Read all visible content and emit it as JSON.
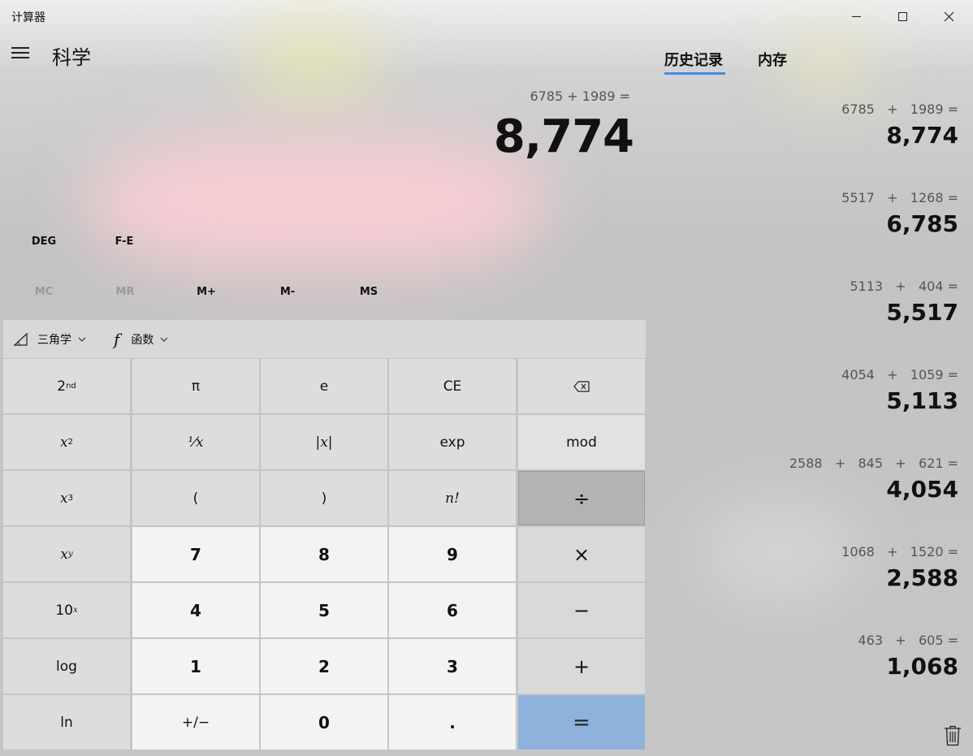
{
  "window": {
    "title": "计算器"
  },
  "header": {
    "mode": "科学"
  },
  "display": {
    "expression": "6785 + 1989 =",
    "result": "8,774"
  },
  "modes": {
    "angle": "DEG",
    "fe": "F-E"
  },
  "memory": {
    "mc": "MC",
    "mr": "MR",
    "mplus": "M+",
    "mminus": "M-",
    "ms": "MS"
  },
  "toolbar": {
    "trig": "三角学",
    "func": "函数"
  },
  "keys": {
    "second": "2",
    "second_sup": "nd",
    "pi": "π",
    "e": "e",
    "ce": "CE",
    "x2": "x",
    "x2_sup": "2",
    "recip": "⅟x",
    "abs": "|x|",
    "exp": "exp",
    "mod": "mod",
    "x3": "x",
    "x3_sup": "3",
    "lparen": "(",
    "rparen": ")",
    "fact": "n!",
    "divide": "÷",
    "xy": "x",
    "xy_sup": "y",
    "seven": "7",
    "eight": "8",
    "nine": "9",
    "multiply": "×",
    "tenx": "10",
    "tenx_sup": "x",
    "four": "4",
    "five": "5",
    "six": "6",
    "minus": "−",
    "log": "log",
    "one": "1",
    "two": "2",
    "three": "3",
    "plus": "+",
    "ln": "ln",
    "negate": "+/−",
    "zero": "0",
    "decimal": ".",
    "equals": "="
  },
  "tabs": {
    "history": "历史记录",
    "memory": "内存"
  },
  "history": [
    {
      "expr": "6785   +   1989 =",
      "result": "8,774"
    },
    {
      "expr": "5517   +   1268 =",
      "result": "6,785"
    },
    {
      "expr": "5113   +   404 =",
      "result": "5,517"
    },
    {
      "expr": "4054   +   1059 =",
      "result": "5,113"
    },
    {
      "expr": "2588   +   845   +   621 =",
      "result": "4,054"
    },
    {
      "expr": "1068   +   1520 =",
      "result": "2,588"
    },
    {
      "expr": "463   +   605 =",
      "result": "1,068"
    }
  ]
}
